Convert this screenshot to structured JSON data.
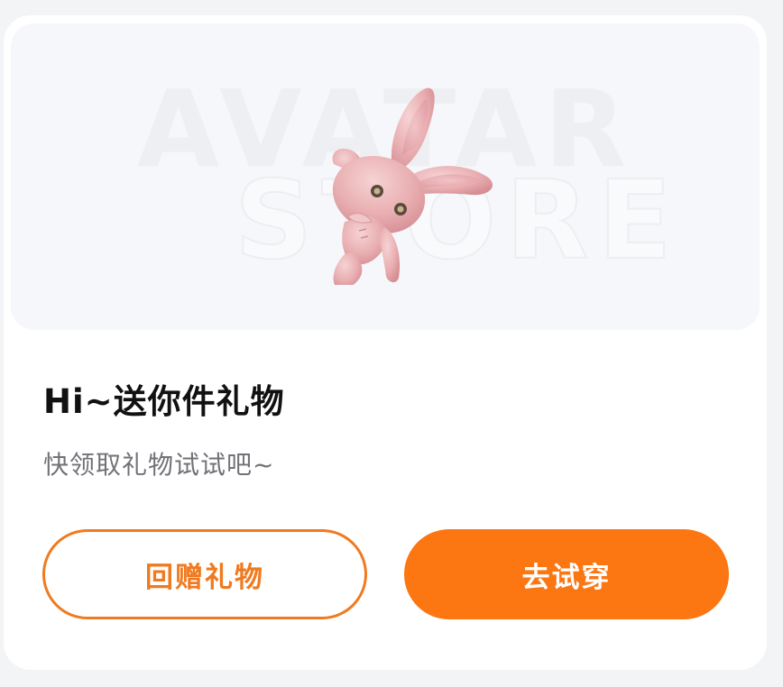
{
  "banner": {
    "watermark_line1": "AVATAR",
    "watermark_line2": "STORE"
  },
  "card": {
    "title": "Hi~送你件礼物",
    "subtitle": "快领取礼物试试吧~"
  },
  "actions": {
    "return_gift_label": "回赠礼物",
    "try_on_label": "去试穿"
  },
  "colors": {
    "accent": "#fc7612",
    "outline": "#f07a1f",
    "title_text": "#111111",
    "subtitle_text": "#707277",
    "banner_bg": "#f6f7fa",
    "page_bg": "#f3f4f6"
  },
  "icons": {
    "banner_image": "pink-bunny-plush"
  }
}
